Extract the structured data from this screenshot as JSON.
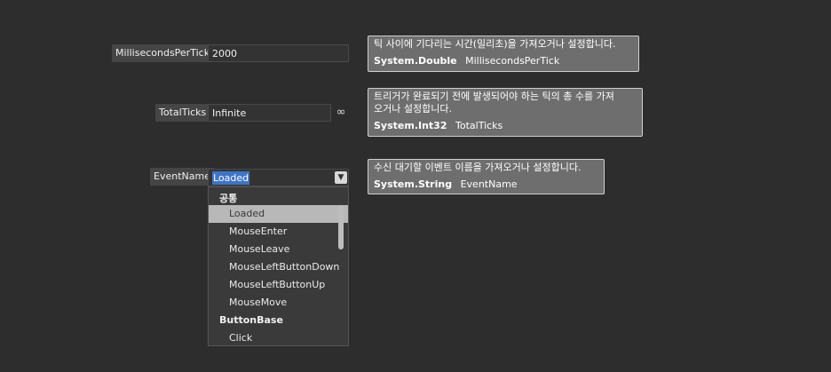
{
  "properties": {
    "milliseconds": {
      "label": "MillisecondsPerTick",
      "value": "2000"
    },
    "total_ticks": {
      "label": "TotalTicks",
      "value": "Infinite",
      "infinity_symbol": "∞"
    },
    "event_name": {
      "label": "EventName",
      "value": "Loaded"
    }
  },
  "tooltips": {
    "milliseconds": {
      "description": "틱 사이에 기다리는 시간(밀리초)을 가져오거나 설정합니다.",
      "type": "System.Double",
      "name": "MillisecondsPerTick"
    },
    "total_ticks": {
      "description_line1": "트리거가 완료되기 전에 발생되어야 하는 틱의 총 수를 가져",
      "description_line2": "오거나 설정합니다.",
      "type": "System.Int32",
      "name": "TotalTicks"
    },
    "event_name": {
      "description": "수신 대기할 이벤트 이름을 가져오거나 설정합니다.",
      "type": "System.String",
      "name": "EventName"
    }
  },
  "dropdown": {
    "items": [
      {
        "kind": "group",
        "label": "공통"
      },
      {
        "kind": "option",
        "label": "Loaded",
        "selected": true
      },
      {
        "kind": "option",
        "label": "MouseEnter"
      },
      {
        "kind": "option",
        "label": "MouseLeave"
      },
      {
        "kind": "option",
        "label": "MouseLeftButtonDown"
      },
      {
        "kind": "option",
        "label": "MouseLeftButtonUp"
      },
      {
        "kind": "option",
        "label": "MouseMove"
      },
      {
        "kind": "group",
        "label": "ButtonBase"
      },
      {
        "kind": "option",
        "label": "Click"
      }
    ],
    "arrow_icon": "chevron-down-icon"
  },
  "colors": {
    "background": "#2d2d2d",
    "tooltip_bg": "#6e6e6e",
    "selection": "#3e74c8",
    "selected_item": "#b8b8b8"
  }
}
